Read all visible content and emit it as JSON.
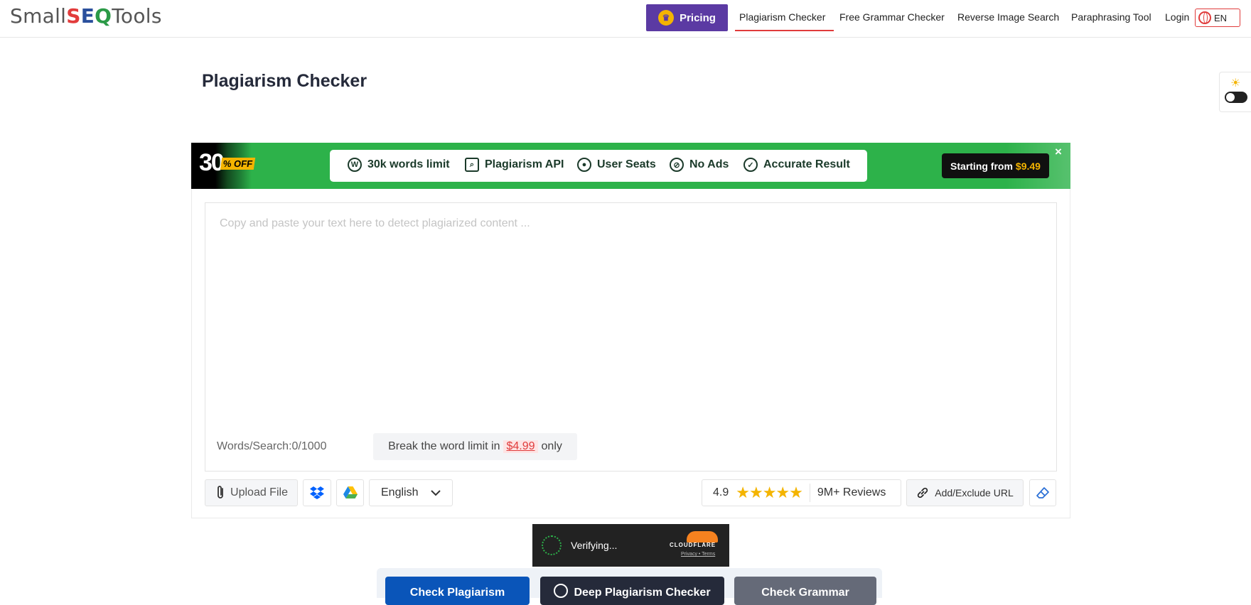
{
  "header": {
    "logo": {
      "part1": "Small",
      "s": "S",
      "e": "E",
      "q": "Q",
      "part2": "Tools"
    },
    "pricing_label": "Pricing",
    "nav": [
      "Plagiarism Checker",
      "Free Grammar Checker",
      "Reverse Image Search",
      "Paraphrasing Tool",
      "Login"
    ],
    "active_nav": "Plagiarism Checker",
    "language": "EN"
  },
  "page_title": "Plagiarism Checker",
  "banner": {
    "discount_number": "30",
    "discount_tag": "% OFF",
    "features": [
      "30k words limit",
      "Plagiarism API",
      "User Seats",
      "No Ads",
      "Accurate Result"
    ],
    "feature_icons": [
      "w-circle-icon",
      "document-search-icon",
      "user-circle-icon",
      "no-ads-icon",
      "check-circle-icon"
    ],
    "starting_label": "Starting from",
    "starting_price": "$9.49",
    "close": "×"
  },
  "editor": {
    "placeholder": "Copy and paste your text here to detect plagiarized content ...",
    "word_count": "Words/Search:0/1000",
    "limit_prefix": "Break the word limit in",
    "limit_price": "$4.99",
    "limit_suffix": "only"
  },
  "toolbar": {
    "upload_label": "Upload File",
    "language": "English",
    "rating": "4.9",
    "reviews": "9M+ Reviews",
    "add_url_label": "Add/Exclude URL"
  },
  "cloudflare": {
    "status": "Verifying...",
    "brand": "CLOUDFLARE",
    "links": "Privacy • Terms"
  },
  "actions": {
    "check_plagiarism": "Check Plagiarism",
    "deep_checker": "Deep Plagiarism Checker",
    "check_grammar": "Check Grammar"
  },
  "colors": {
    "brand_purple": "#5b3aa3",
    "banner_green": "#2db24a",
    "primary_blue": "#0a55b9",
    "accent_red": "#e03b3b",
    "star_yellow": "#f4b400"
  }
}
